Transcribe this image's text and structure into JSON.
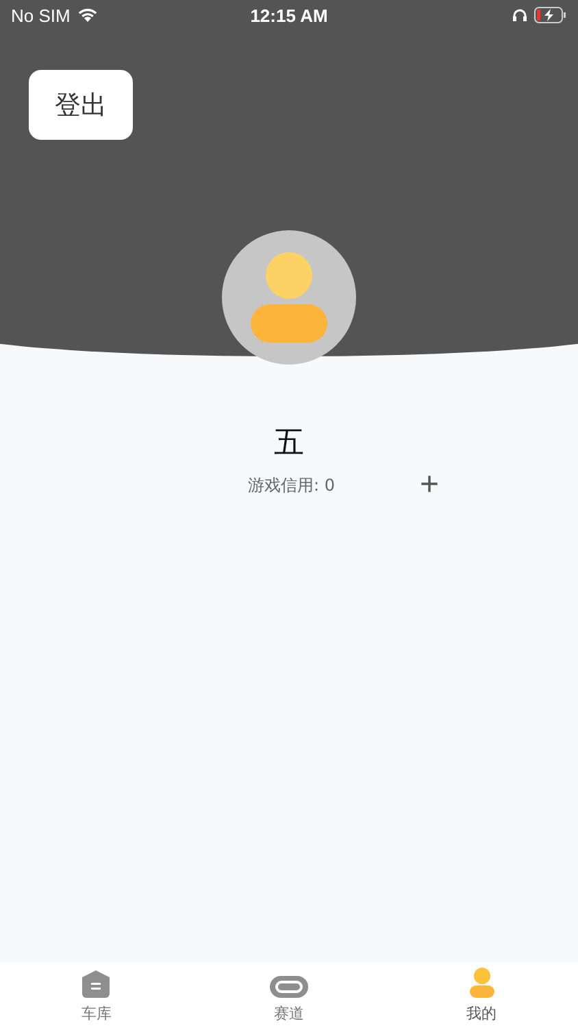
{
  "status_bar": {
    "carrier": "No SIM",
    "time": "12:15 AM"
  },
  "logout_button": "登出",
  "profile": {
    "name": "五",
    "credit": "游戏信用: 0",
    "add": "+"
  },
  "tabs": [
    {
      "label": "车库",
      "kind": "garage",
      "selected": false
    },
    {
      "label": "赛道",
      "kind": "track",
      "selected": false
    },
    {
      "label": "我的",
      "kind": "profile",
      "selected": true
    }
  ]
}
